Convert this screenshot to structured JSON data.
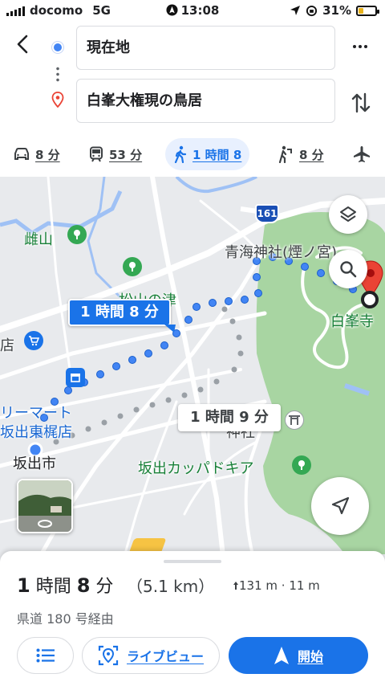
{
  "status_bar": {
    "carrier": "docomo",
    "network": "5G",
    "time": "13:08",
    "battery": "31%"
  },
  "directions": {
    "origin": "現在地",
    "destination": "白峯大権現の鳥居",
    "modes": [
      {
        "icon": "car-icon",
        "label": "8 分"
      },
      {
        "icon": "train-icon",
        "label": "53 分"
      },
      {
        "icon": "walk-icon",
        "label": "1 時間 8",
        "active": true
      },
      {
        "icon": "rideshare-icon",
        "label": "8 分"
      },
      {
        "icon": "flight-icon",
        "label": ""
      }
    ]
  },
  "map": {
    "route_shield": "161",
    "labels": {
      "mountain": "雌山",
      "shrine": "青海神社(煙ノ宮)",
      "temple": "白峯寺",
      "matsuyama": "松山の津",
      "store_partial": "店",
      "mart1": "リーマート",
      "mart2": "坂出東梶店",
      "city": "坂出市",
      "kappa": "坂出カッパドキア",
      "jinja": "神社"
    },
    "route_badge": "1 時間 8 分",
    "alt_badge": "1 時間 9 分"
  },
  "summary": {
    "duration_num1": "1",
    "duration_unit1": "時間",
    "duration_num2": "8",
    "duration_unit2": "分",
    "distance": "（5.1 km）",
    "elevation": "131 m · 11 m",
    "via": "県道 180 号経由",
    "liveview_label": "ライブビュー",
    "start_label": "開始"
  },
  "colors": {
    "accent": "#1a73e8",
    "route": "#4285f4",
    "destination_pin": "#ea4335",
    "park": "#a8d5a2"
  }
}
